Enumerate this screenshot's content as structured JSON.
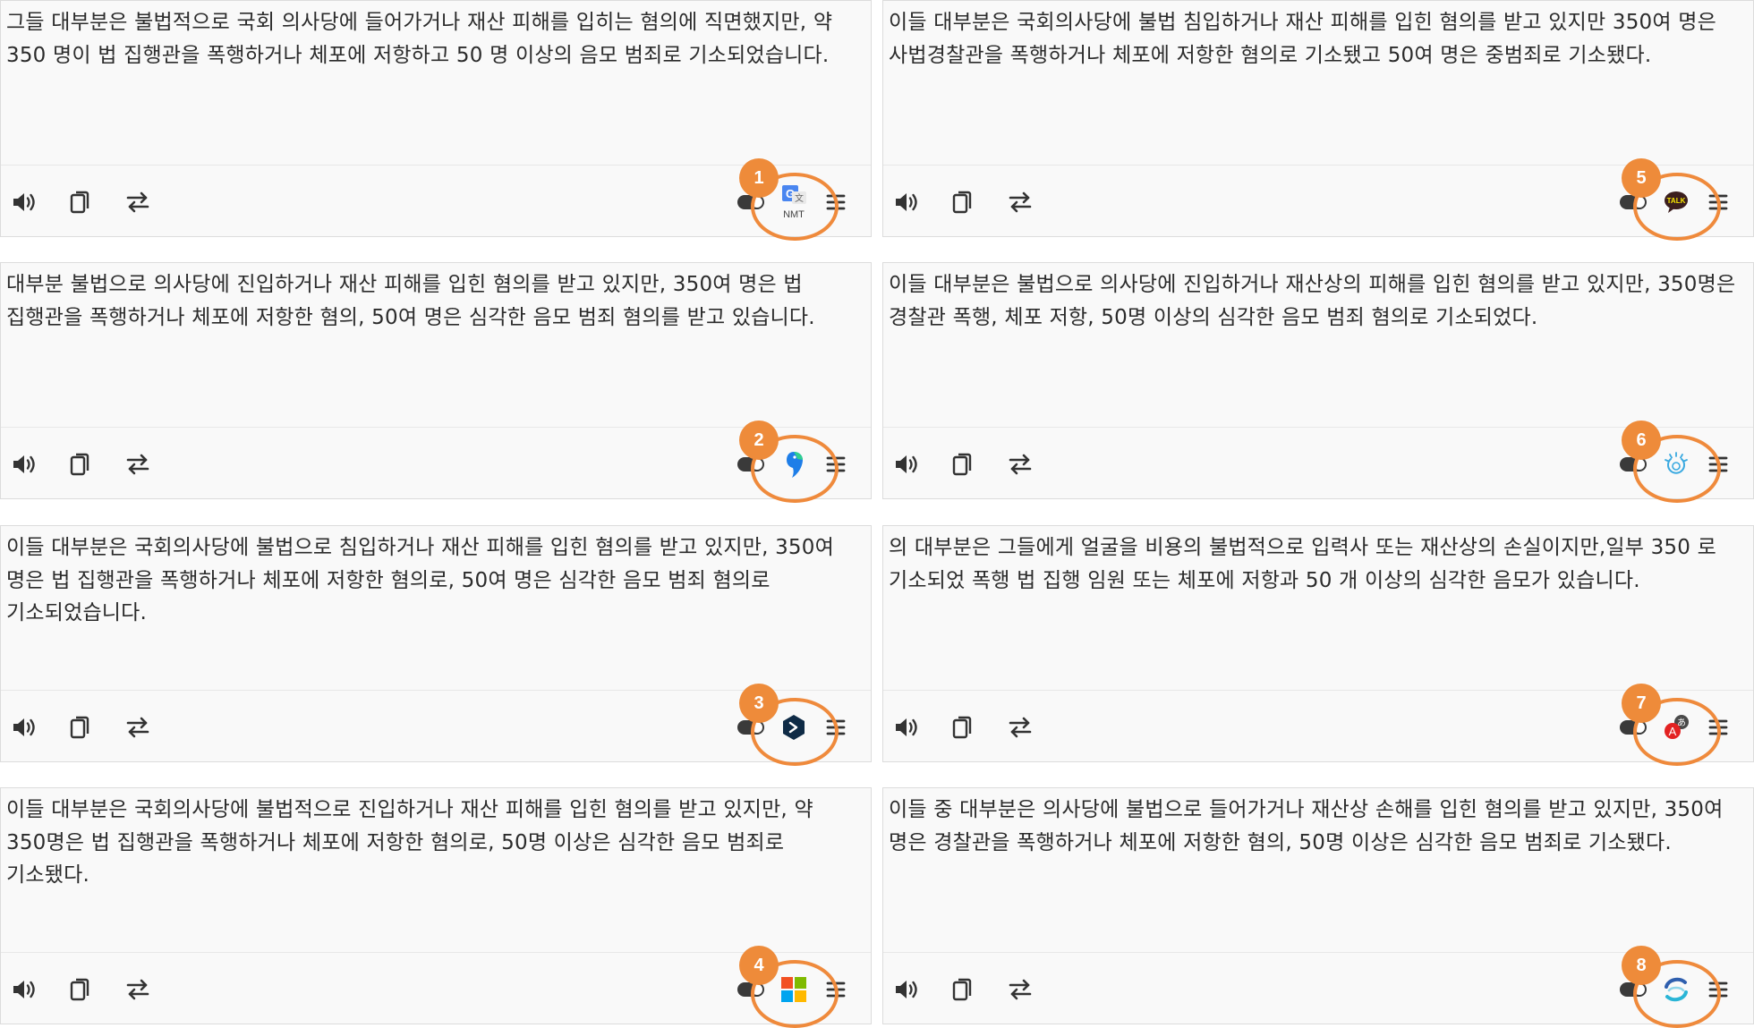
{
  "panels": [
    {
      "text": "그들 대부분은 불법적으로 국회 의사당에 들어가거나 재산 피해를 입히는 혐의에 직면했지만, 약 350 명이 법 집행관을 폭행하거나 체포에 저항하고 50 명 이상의 음모 범죄로 기소되었습니다.",
      "badge": "1",
      "engine_icon": "google-translate-nmt-icon",
      "engine_label": "NMT"
    },
    {
      "text": "대부분 불법으로 의사당에 진입하거나 재산 피해를 입힌 혐의를 받고 있지만, 350여 명은 법 집행관을 폭행하거나 체포에 저항한 혐의, 50여 명은 심각한 음모 범죄 혐의를 받고 있습니다.",
      "badge": "2",
      "engine_icon": "papago-parrot-icon"
    },
    {
      "text": "이들 대부분은 국회의사당에 불법으로 침입하거나 재산 피해를 입힌 혐의를 받고 있지만, 350여 명은 법 집행관을 폭행하거나 체포에 저항한 혐의로, 50여 명은 심각한 음모 범죄 혐의로 기소되었습니다.",
      "badge": "3",
      "engine_icon": "deepl-icon"
    },
    {
      "text": "이들 대부분은 국회의사당에 불법적으로 진입하거나 재산 피해를 입힌 혐의를 받고 있지만, 약 350명은 법 집행관을 폭행하거나 체포에 저항한 혐의로, 50명 이상은 심각한 음모 범죄로 기소됐다.",
      "badge": "4",
      "engine_icon": "microsoft-logo-icon"
    },
    {
      "text": "이들 대부분은 국회의사당에 불법 침입하거나 재산 피해를 입힌 혐의를 받고 있지만 350여 명은 사법경찰관을 폭행하거나 체포에 저항한 혐의로 기소됐고 50여 명은 중범죄로 기소됐다.",
      "badge": "5",
      "engine_icon": "kakao-talk-icon",
      "engine_label": "TALK"
    },
    {
      "text": "이들 대부분은 불법으로 의사당에 진입하거나 재산상의 피해를 입힌 혐의를 받고 있지만, 350명은 경찰관 폭행, 체포 저항, 50명 이상의 심각한 음모 범죄 혐의로 기소되었다.",
      "badge": "6",
      "engine_icon": "ibm-watson-icon"
    },
    {
      "text": "의 대부분은 그들에게 얼굴을 비용의 불법적으로 입력사 또는 재산상의 손실이지만,일부 350 로 기소되었 폭행 법 집행 임원 또는 체포에 저항과 50 개 이상의 심각한 음모가 있습니다.",
      "badge": "7",
      "engine_icon": "translator-a-icon",
      "engine_label": "A"
    },
    {
      "text": "이들 중 대부분은 의사당에 불법으로 들어가거나 재산상 손해를 입힌 혐의를 받고 있지만, 350여 명은 경찰관을 폭행하거나 체포에 저항한 혐의, 50명 이상은 심각한 음모 범죄로 기소됐다.",
      "badge": "8",
      "engine_icon": "systran-icon"
    }
  ],
  "toolbar_icons": [
    "speaker-icon",
    "copy-icon",
    "swap-icon",
    "toggle-icon",
    "menu-icon"
  ],
  "colors": {
    "highlight": "#ef8a3c",
    "panel_bg": "#f9f9f9",
    "text": "#2b2b2b",
    "icon": "#333333"
  }
}
